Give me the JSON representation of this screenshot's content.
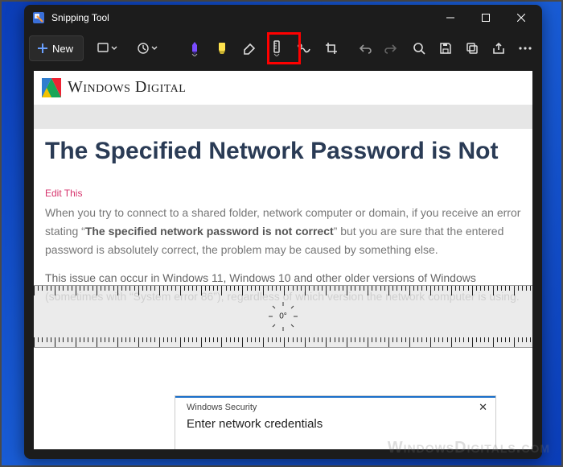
{
  "window": {
    "title": "Snipping Tool",
    "new_label": "New"
  },
  "toolbar": {
    "mode": "rectangle",
    "delay": "no-delay",
    "pen_color": "#7a4cff",
    "highlighter_color": "#ffe34d"
  },
  "brand": {
    "name": "Windows Digital"
  },
  "article": {
    "heading": "The Specified Network Password is Not",
    "edit_label": "Edit This",
    "p1_a": "When you try to connect to a shared folder, network computer or domain, if you receive an error stating “",
    "p1_bold": "The specified network password is not correct",
    "p1_b": "” but you are sure that the entered password is absolutely correct, the problem may be caused by something else.",
    "p2": "This issue can occur in Windows 11, Windows 10 and other older versions of Windows (sometimes with “System error 86”), regardless of which version the network computer is using."
  },
  "ruler": {
    "angle_label": "0°"
  },
  "security_dialog": {
    "title": "Windows Security",
    "body": "Enter network credentials"
  },
  "watermark": "WindowsDigitals.com",
  "highlight": {
    "target": "ruler-tool"
  }
}
